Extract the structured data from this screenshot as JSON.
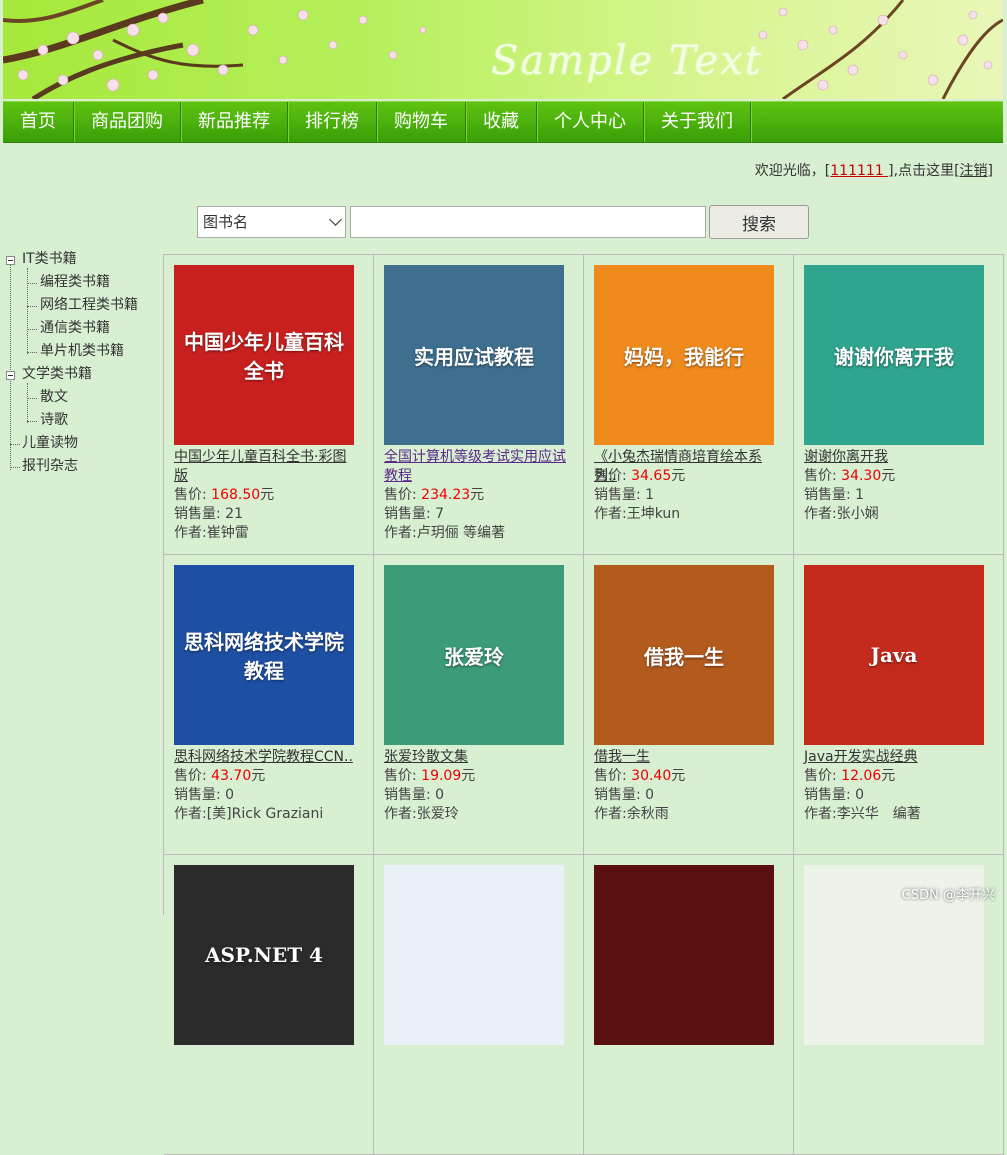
{
  "banner": {
    "text": "Sample Text"
  },
  "nav": [
    "首页",
    "商品团购",
    "新品推荐",
    "排行榜",
    "购物车",
    "收藏",
    "个人中心",
    "关于我们"
  ],
  "welcome": {
    "prefix": "欢迎光临，[",
    "user": "111111 ",
    "middle": "],点击这里[",
    "logout": "注销",
    "suffix": "]"
  },
  "search": {
    "select_value": "图书名",
    "input_value": "",
    "button": "搜索"
  },
  "tree": {
    "it": "IT类书籍",
    "programming": "编程类书籍",
    "network": "网络工程类书籍",
    "comm": "通信类书籍",
    "mcu": "单片机类书籍",
    "literature": "文学类书籍",
    "prose": "散文",
    "poetry": "诗歌",
    "children": "儿童读物",
    "magazine": "报刊杂志"
  },
  "labels": {
    "price": "售价:",
    "sales": "销售量:",
    "author": "作者:",
    "yuan": "元"
  },
  "books": [
    {
      "title": "中国少年儿童百科全书·彩图版",
      "price": "168.50",
      "sales": "21",
      "author": "崔钟雷",
      "cover_text": "中国少年儿童百科全书",
      "cover_color": "#c8201e"
    },
    {
      "title": "全国计算机等级考试实用应试教程",
      "price": "234.23",
      "sales": "7",
      "author": "卢玥俪 等编著",
      "cover_text": "实用应试教程",
      "cover_color": "#3e6f8f"
    },
    {
      "title": "《小兔杰瑞情商培育绘本系列..",
      "price": "34.65",
      "sales": "1",
      "author": "王坤kun",
      "cover_text": "妈妈，我能行",
      "cover_color": "#f08a1c"
    },
    {
      "title": "谢谢你离开我",
      "price": "34.30",
      "sales": "1",
      "author": "张小娴",
      "cover_text": "谢谢你离开我",
      "cover_color": "#2fa48e"
    },
    {
      "title": "思科网络技术学院教程CCN..",
      "price": "43.70",
      "sales": "0",
      "author": "[美]Rick Graziani",
      "cover_text": "思科网络技术学院教程",
      "cover_color": "#1d4fa3"
    },
    {
      "title": "张爱玲散文集",
      "price": "19.09",
      "sales": "0",
      "author": "张爱玲",
      "cover_text": "张爱玲",
      "cover_color": "#3c9b78"
    },
    {
      "title": "借我一生",
      "price": "30.40",
      "sales": "0",
      "author": "余秋雨",
      "cover_text": "借我一生",
      "cover_color": "#b35a1d"
    },
    {
      "title": "Java开发实战经典",
      "price": "12.06",
      "sales": "0",
      "author": "李兴华　编著",
      "cover_text": "Java",
      "cover_color": "#c42b1c"
    },
    {
      "title": "",
      "price": "",
      "sales": "",
      "author": "",
      "cover_text": "ASP.NET 4",
      "cover_color": "#2b2b2b"
    },
    {
      "title": "",
      "price": "",
      "sales": "",
      "author": "",
      "cover_text": "",
      "cover_color": "#e9f0f8"
    },
    {
      "title": "",
      "price": "",
      "sales": "",
      "author": "",
      "cover_text": "",
      "cover_color": "#5a0f10"
    },
    {
      "title": "",
      "price": "",
      "sales": "",
      "author": "",
      "cover_text": "",
      "cover_color": "#eef3ea"
    }
  ],
  "watermark": "CSDN @李开兴"
}
